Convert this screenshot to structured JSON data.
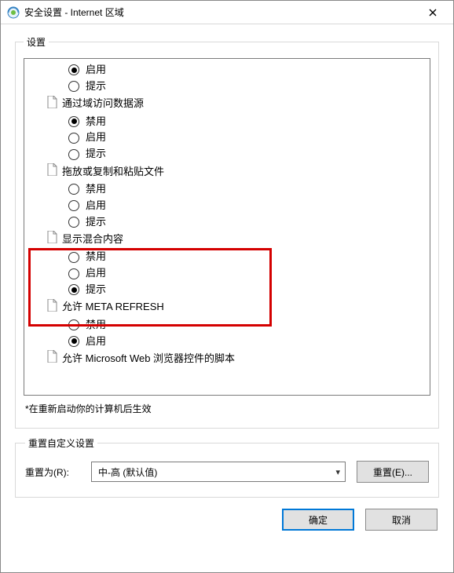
{
  "window": {
    "title": "安全设置 - Internet 区域"
  },
  "settings_group": {
    "legend": "设置",
    "restart_note": "*在重新启动你的计算机后生效",
    "categories": [
      {
        "label": "",
        "options": [
          {
            "label": "启用",
            "selected": true
          },
          {
            "label": "提示",
            "selected": false
          }
        ]
      },
      {
        "label": "通过域访问数据源",
        "options": [
          {
            "label": "禁用",
            "selected": true
          },
          {
            "label": "启用",
            "selected": false
          },
          {
            "label": "提示",
            "selected": false
          }
        ]
      },
      {
        "label": "拖放或复制和粘贴文件",
        "options": [
          {
            "label": "禁用",
            "selected": false
          },
          {
            "label": "启用",
            "selected": false
          },
          {
            "label": "提示",
            "selected": false
          }
        ]
      },
      {
        "label": "显示混合内容",
        "highlight": true,
        "options": [
          {
            "label": "禁用",
            "selected": false
          },
          {
            "label": "启用",
            "selected": false
          },
          {
            "label": "提示",
            "selected": true
          }
        ]
      },
      {
        "label": "允许 META REFRESH",
        "options": [
          {
            "label": "禁用",
            "selected": false
          },
          {
            "label": "启用",
            "selected": true
          }
        ]
      },
      {
        "label": "允许 Microsoft Web 浏览器控件的脚本",
        "options": []
      }
    ]
  },
  "reset_group": {
    "legend": "重置自定义设置",
    "label": "重置为(R):",
    "selected_value": "中-高 (默认值)",
    "reset_button": "重置(E)..."
  },
  "footer": {
    "ok": "确定",
    "cancel": "取消"
  }
}
